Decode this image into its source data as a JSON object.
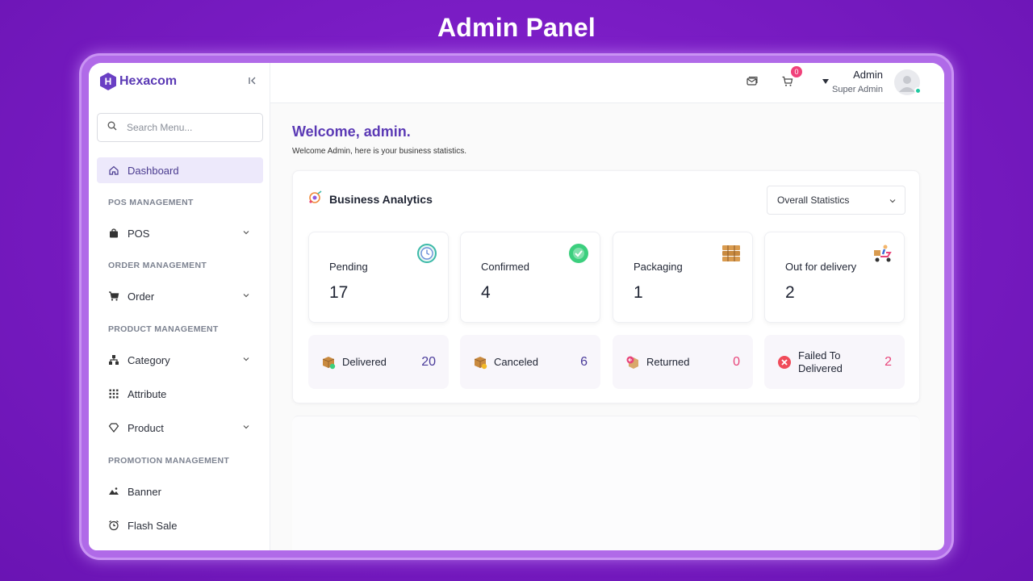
{
  "banner": {
    "title": "Admin Panel"
  },
  "brand": {
    "logo_letter": "H",
    "name": "Hexacom"
  },
  "search": {
    "placeholder": "Search Menu..."
  },
  "sidebar": {
    "dashboard": "Dashboard",
    "sections": {
      "pos": "POS MANAGEMENT",
      "order": "ORDER MANAGEMENT",
      "product": "PRODUCT MANAGEMENT",
      "promotion": "PROMOTION MANAGEMENT"
    },
    "items": {
      "pos": "POS",
      "order": "Order",
      "category": "Category",
      "attribute": "Attribute",
      "product": "Product",
      "banner": "Banner",
      "flash_sale": "Flash Sale"
    }
  },
  "topbar": {
    "cart_count": "0",
    "user_name": "Admin",
    "user_role": "Super Admin"
  },
  "main": {
    "welcome_title": "Welcome, admin.",
    "welcome_subtitle": "Welcome Admin, here is your business statistics.",
    "analytics_title": "Business Analytics",
    "stat_filter": "Overall Statistics",
    "stats": [
      {
        "label": "Pending",
        "value": "17"
      },
      {
        "label": "Confirmed",
        "value": "4"
      },
      {
        "label": "Packaging",
        "value": "1"
      },
      {
        "label": "Out for delivery",
        "value": "2"
      }
    ],
    "status": [
      {
        "label": "Delivered",
        "value": "20"
      },
      {
        "label": "Canceled",
        "value": "6"
      },
      {
        "label": "Returned",
        "value": "0"
      },
      {
        "label_line1": "Failed To",
        "label_line2": "Delivered",
        "value": "2"
      }
    ]
  },
  "colors": {
    "accent": "#5b3ab5",
    "delivered_value": "#4a3b9a",
    "canceled_value": "#4a3b9a",
    "returned_value": "#e8457a",
    "failed_value": "#e8457a",
    "badge": "#f0417a",
    "online": "#1dc9a0"
  }
}
